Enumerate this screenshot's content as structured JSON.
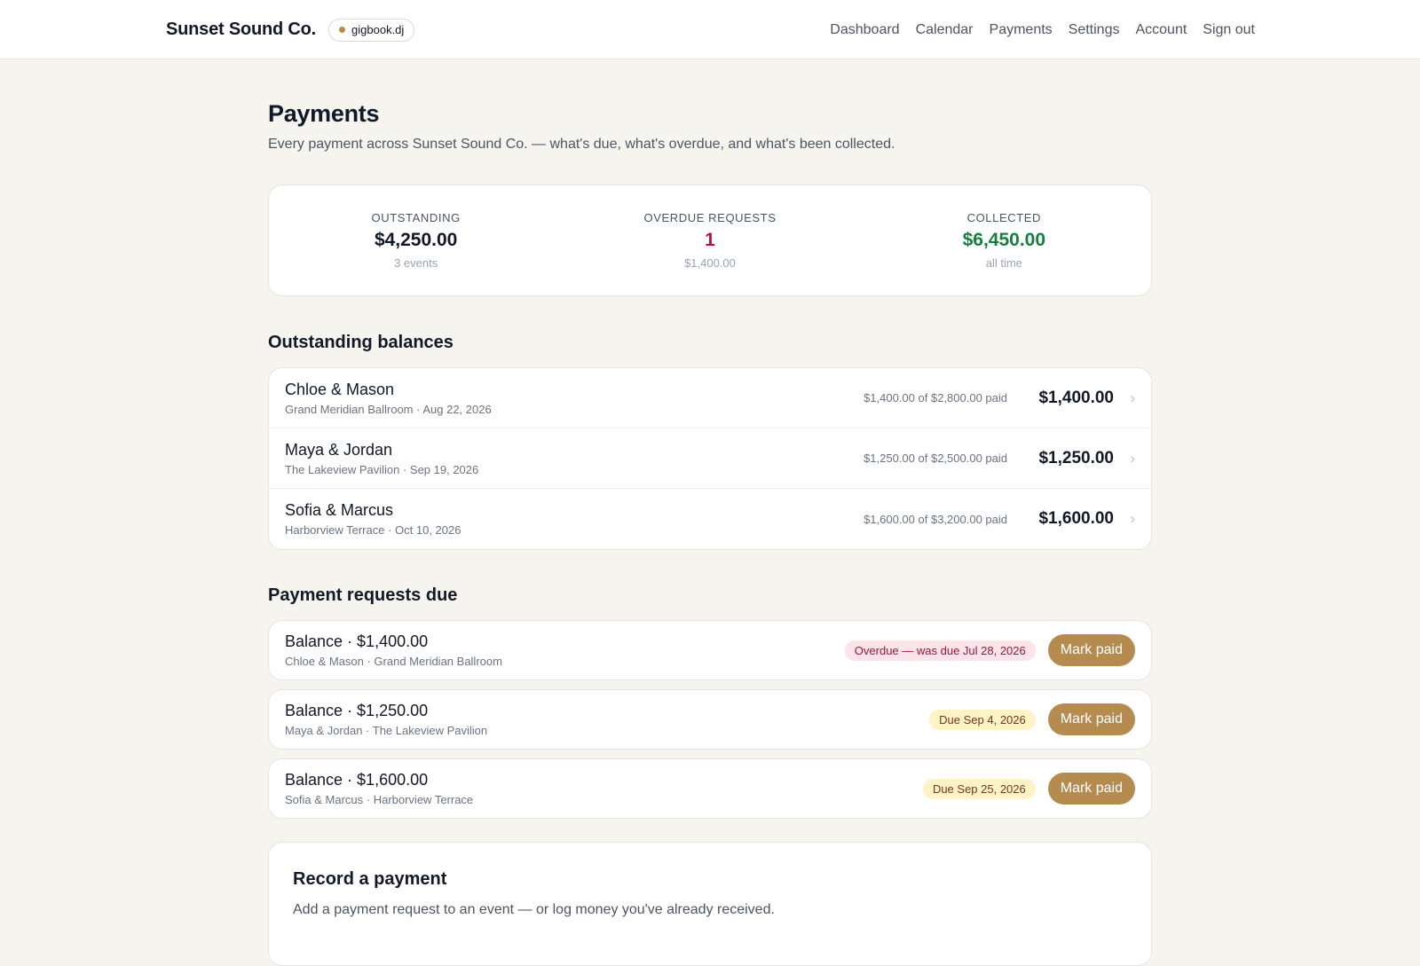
{
  "header": {
    "brand": "Sunset Sound Co.",
    "chip": "gigbook.dj",
    "nav": [
      "Dashboard",
      "Calendar",
      "Payments",
      "Settings",
      "Account",
      "Sign out"
    ]
  },
  "page": {
    "title": "Payments",
    "subtitle": "Every payment across Sunset Sound Co. — what's due, what's overdue, and what's been collected."
  },
  "stats": [
    {
      "label": "OUTSTANDING",
      "value": "$4,250.00",
      "note": "3 events"
    },
    {
      "label": "OVERDUE REQUESTS",
      "value": "1",
      "note": "$1,400.00"
    },
    {
      "label": "COLLECTED",
      "value": "$6,450.00",
      "note": "all time"
    }
  ],
  "balances": {
    "title": "Outstanding balances",
    "rows": [
      {
        "name": "Chloe & Mason",
        "meta": "Grand Meridian Ballroom · Aug 22, 2026",
        "progress": "$1,400.00 of $2,800.00 paid",
        "amount": "$1,400.00"
      },
      {
        "name": "Maya & Jordan",
        "meta": "The Lakeview Pavilion · Sep 19, 2026",
        "progress": "$1,250.00 of $2,500.00 paid",
        "amount": "$1,250.00"
      },
      {
        "name": "Sofia & Marcus",
        "meta": "Harborview Terrace · Oct 10, 2026",
        "progress": "$1,600.00 of $3,200.00 paid",
        "amount": "$1,600.00"
      }
    ]
  },
  "requests": {
    "title": "Payment requests due",
    "button_label": "Mark paid",
    "rows": [
      {
        "title": "Balance · $1,400.00",
        "meta": "Chloe & Mason · Grand Meridian Ballroom",
        "badge": "Overdue — was due Jul 28, 2026"
      },
      {
        "title": "Balance · $1,250.00",
        "meta": "Maya & Jordan · The Lakeview Pavilion",
        "badge": "Due Sep 4, 2026"
      },
      {
        "title": "Balance · $1,600.00",
        "meta": "Sofia & Marcus · Harborview Terrace",
        "badge": "Due Sep 25, 2026"
      }
    ]
  },
  "record": {
    "title": "Record a payment",
    "subtitle": "Add a payment request to an event — or log money you've already received."
  },
  "colors": {
    "accent": "#b58b50",
    "overdue": "#be123c",
    "collected": "#15803d"
  }
}
